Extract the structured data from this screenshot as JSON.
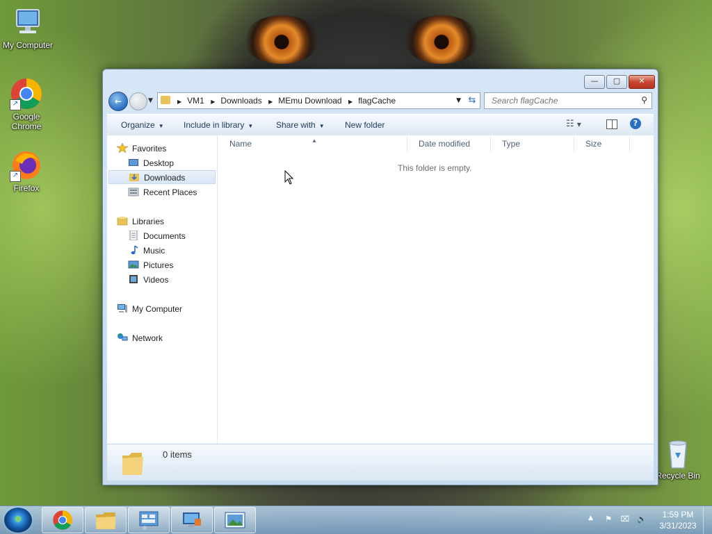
{
  "desktop": {
    "icons": [
      {
        "label": "My Computer"
      },
      {
        "label": "Google Chrome"
      },
      {
        "label": "Firefox"
      },
      {
        "label": "Recycle Bin"
      }
    ]
  },
  "window": {
    "controls": {
      "minimize": "—",
      "maximize": "▢",
      "close": "✕"
    },
    "breadcrumb": [
      "VM1",
      "Downloads",
      "MEmu Download",
      "flagCache"
    ],
    "search": {
      "placeholder": "Search flagCache",
      "value": ""
    },
    "toolbar": {
      "organize": "Organize",
      "include_in_library": "Include in library",
      "share_with": "Share with",
      "new_folder": "New folder"
    },
    "nav": {
      "favorites": "Favorites",
      "desktop": "Desktop",
      "downloads": "Downloads",
      "recent_places": "Recent Places",
      "libraries": "Libraries",
      "documents": "Documents",
      "music": "Music",
      "pictures": "Pictures",
      "videos": "Videos",
      "my_computer": "My Computer",
      "network": "Network"
    },
    "columns": {
      "name": "Name",
      "date_modified": "Date modified",
      "type": "Type",
      "size": "Size"
    },
    "empty_message": "This folder is empty.",
    "status": {
      "items": "0 items"
    }
  },
  "taskbar": {
    "clock": {
      "time": "1:59 PM",
      "date": "3/31/2023"
    }
  }
}
